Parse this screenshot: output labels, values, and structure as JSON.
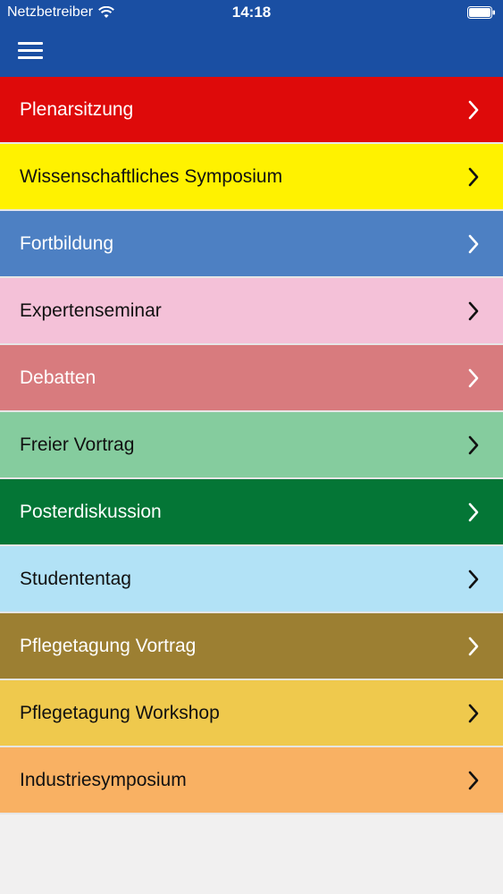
{
  "status_bar": {
    "carrier": "Netzbetreiber",
    "time": "14:18",
    "wifi_icon": "wifi-icon",
    "battery_icon": "battery-icon"
  },
  "nav": {
    "menu_icon": "hamburger-menu-icon",
    "background_color": "#1a4fa3"
  },
  "menu": {
    "items": [
      {
        "label": "Plenarsitzung",
        "color": "#de0a0a",
        "text_color": "#ffffff"
      },
      {
        "label": "Wissenschaftliches Symposium",
        "color": "#fff200",
        "text_color": "#111111"
      },
      {
        "label": "Fortbildung",
        "color": "#4d80c3",
        "text_color": "#ffffff"
      },
      {
        "label": "Expertenseminar",
        "color": "#f4c1d8",
        "text_color": "#111111"
      },
      {
        "label": "Debatten",
        "color": "#d87b7e",
        "text_color": "#ffffff"
      },
      {
        "label": "Freier Vortrag",
        "color": "#85cc9e",
        "text_color": "#111111"
      },
      {
        "label": "Posterdiskussion",
        "color": "#047636",
        "text_color": "#ffffff"
      },
      {
        "label": "Studententag",
        "color": "#b2e2f6",
        "text_color": "#111111"
      },
      {
        "label": "Pflegetagung Vortrag",
        "color": "#9c7f32",
        "text_color": "#ffffff"
      },
      {
        "label": "Pflegetagung Workshop",
        "color": "#efc94d",
        "text_color": "#111111"
      },
      {
        "label": "Industriesymposium",
        "color": "#f9b163",
        "text_color": "#111111"
      }
    ],
    "chevron_icon": "chevron-right-icon"
  }
}
